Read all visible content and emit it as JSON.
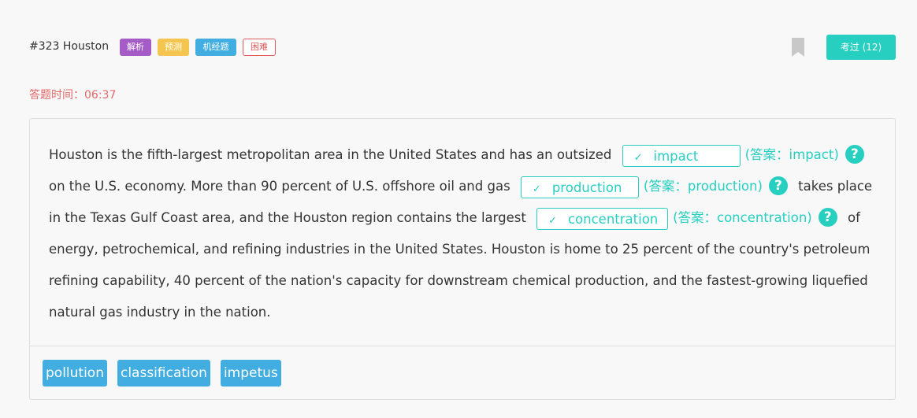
{
  "header": {
    "title": "#323 Houston",
    "tags": [
      "解析",
      "预测",
      "机经题",
      "困难"
    ],
    "exam_button": "考过 (12)"
  },
  "timer": {
    "label": "答题时间：",
    "value": "06:37"
  },
  "passage": {
    "seg1": "Houston is the fifth-largest metropolitan area in the United States and has an outsized",
    "blank1": "impact",
    "answer1": "(答案：impact)",
    "seg2": "on the U.S. economy. More than 90 percent of U.S. offshore oil and gas",
    "blank2": "production",
    "answer2": "(答案：production)",
    "seg3": "takes place in the Texas Gulf Coast area, and the Houston region contains the largest",
    "blank3": "concentration",
    "answer3": "(答案：concentration)",
    "seg4": "of energy, petrochemical, and refining industries in the United States. Houston is home to 25 percent of the country's petroleum refining capability, 40 percent of the nation's capacity for downstream chemical production, and the fastest-growing liquefied natural gas industry in the nation."
  },
  "check_mark": "✓",
  "help_mark": "?",
  "options": [
    "pollution",
    "classification",
    "impetus"
  ],
  "colors": {
    "accent": "#26cfc0",
    "option": "#41ade0",
    "timer": "#e46868"
  }
}
